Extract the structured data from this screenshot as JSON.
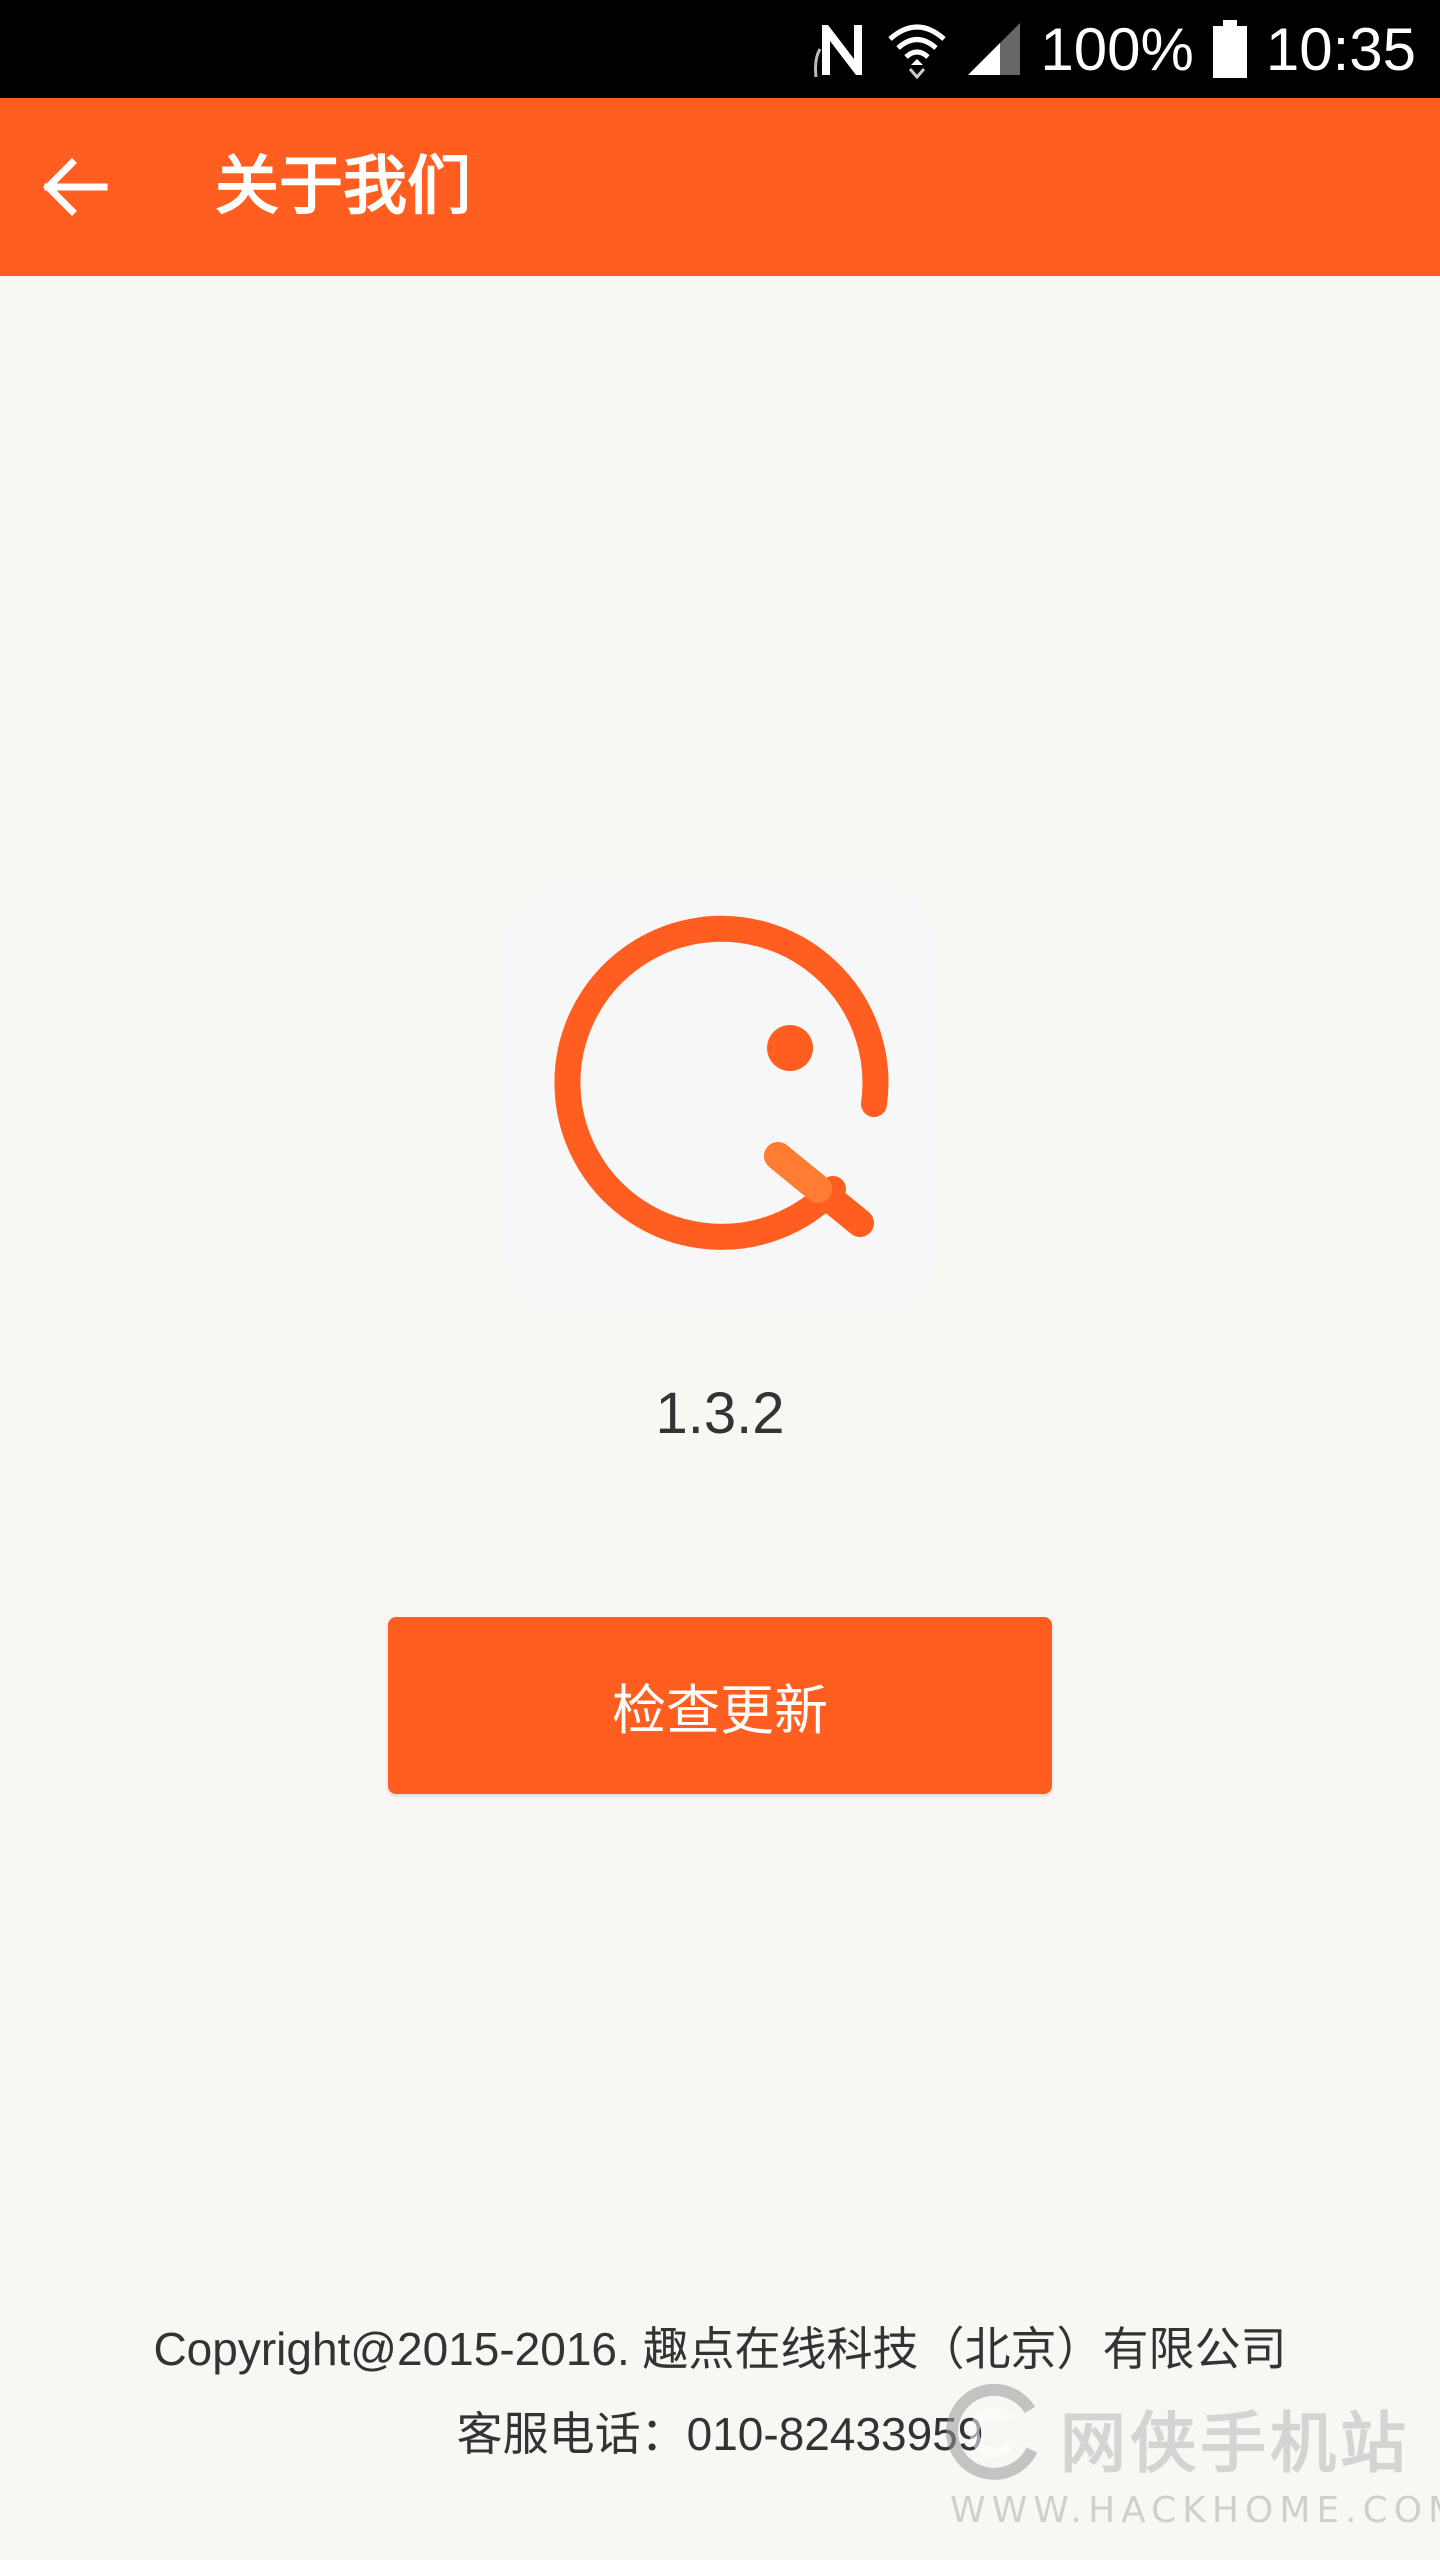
{
  "status_bar": {
    "nfc_icon": "nfc-icon",
    "wifi_icon": "wifi-icon",
    "signal_icon": "signal-icon",
    "battery_percent": "100%",
    "battery_icon": "battery-icon",
    "time": "10:35"
  },
  "app_bar": {
    "back_icon": "arrow-left-icon",
    "title": "关于我们"
  },
  "about": {
    "logo_icon": "qudian-logo",
    "version": "1.3.2",
    "update_button_label": "检查更新",
    "copyright": "Copyright@2015-2016. 趣点在线科技（北京）有限公司",
    "phone": "客服电话：010-82433959"
  },
  "watermark": {
    "logo_icon": "hackhome-logo",
    "name": "网侠手机站",
    "url": "WWW.HACKHOME.COM"
  },
  "colors": {
    "accent": "#ff5e20",
    "background": "#f8f7f4",
    "text": "#333333"
  }
}
